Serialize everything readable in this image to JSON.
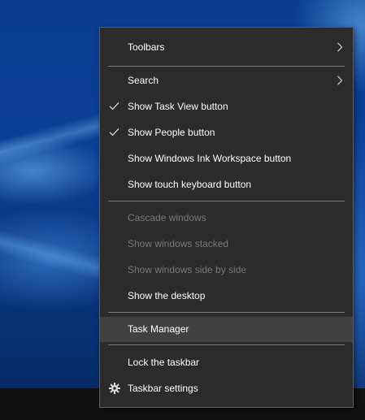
{
  "menu": {
    "toolbars": {
      "label": "Toolbars",
      "icon": "chevron-right-icon"
    },
    "search": {
      "label": "Search",
      "icon": "chevron-right-icon"
    },
    "show_task_view": {
      "label": "Show Task View button",
      "checked": true,
      "icon": "check-icon"
    },
    "show_people": {
      "label": "Show People button",
      "checked": true,
      "icon": "check-icon"
    },
    "show_ink_workspace": {
      "label": "Show Windows Ink Workspace button",
      "checked": false
    },
    "show_touch_keyboard": {
      "label": "Show touch keyboard button",
      "checked": false
    },
    "cascade_windows": {
      "label": "Cascade windows",
      "disabled": true
    },
    "show_windows_stacked": {
      "label": "Show windows stacked",
      "disabled": true
    },
    "show_side_by_side": {
      "label": "Show windows side by side",
      "disabled": true
    },
    "show_desktop": {
      "label": "Show the desktop"
    },
    "task_manager": {
      "label": "Task Manager",
      "highlighted": true
    },
    "lock_taskbar": {
      "label": "Lock the taskbar",
      "checked": false
    },
    "taskbar_settings": {
      "label": "Taskbar settings",
      "icon": "gear-icon"
    }
  },
  "colors": {
    "menu_background": "#2b2b2b",
    "menu_border": "#5e5e5e",
    "highlight": "#414141",
    "text": "#ffffff",
    "disabled_text": "#7a7a7a",
    "separator": "#7d7d7d",
    "taskbar": "#101010",
    "desktop": "#0a3d8f"
  }
}
